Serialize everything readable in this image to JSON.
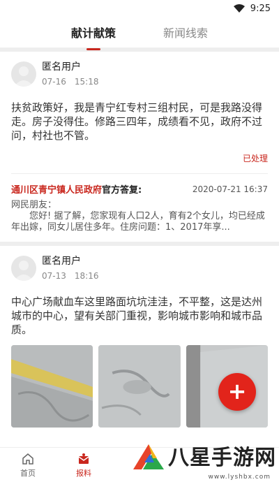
{
  "status_bar": {
    "time": "9:25",
    "icons": [
      "wifi-icon",
      "signal-icon"
    ]
  },
  "tabs": [
    {
      "label": "献计献策",
      "active": true
    },
    {
      "label": "新闻线索",
      "active": false
    }
  ],
  "posts": [
    {
      "user": "匿名用户",
      "date": "07-16",
      "time": "15:18",
      "content": "扶贫政策好，我是青宁红专村三组村民，可是我路没得走。房子没得住。修路三四年，成绩看不见，政府不过问，村社也不管。",
      "status": "已处理",
      "reply": {
        "org": "通川区青宁镇人民政府",
        "label": "官方答复:",
        "time": "2020-07-21 16:37",
        "greeting": "网民朋友：",
        "body": "您好! 据了解，您家现有人口2人，育有2个女儿，均已经成年出嫁，同女儿居住多年。住房问题：1、2017年享..."
      }
    },
    {
      "user": "匿名用户",
      "date": "07-13",
      "time": "18:16",
      "content": "中心广场献血车这里路面坑坑洼洼，不平整，这是达州城市的中心，望有关部门重视，影响城市影响和城市品质。",
      "photos": [
        "road-photo-1",
        "road-photo-2",
        "road-photo-3"
      ]
    }
  ],
  "fab": {
    "label": "+",
    "icon": "plus-icon"
  },
  "bottom_nav": [
    {
      "label": "首页",
      "icon": "home-icon",
      "active": false
    },
    {
      "label": "报料",
      "icon": "report-icon",
      "active": true
    }
  ],
  "watermark": {
    "text": "八星手游网",
    "url": "www.lyshbx.com"
  },
  "colors": {
    "accent": "#c9271e",
    "fab": "#e2241b"
  }
}
